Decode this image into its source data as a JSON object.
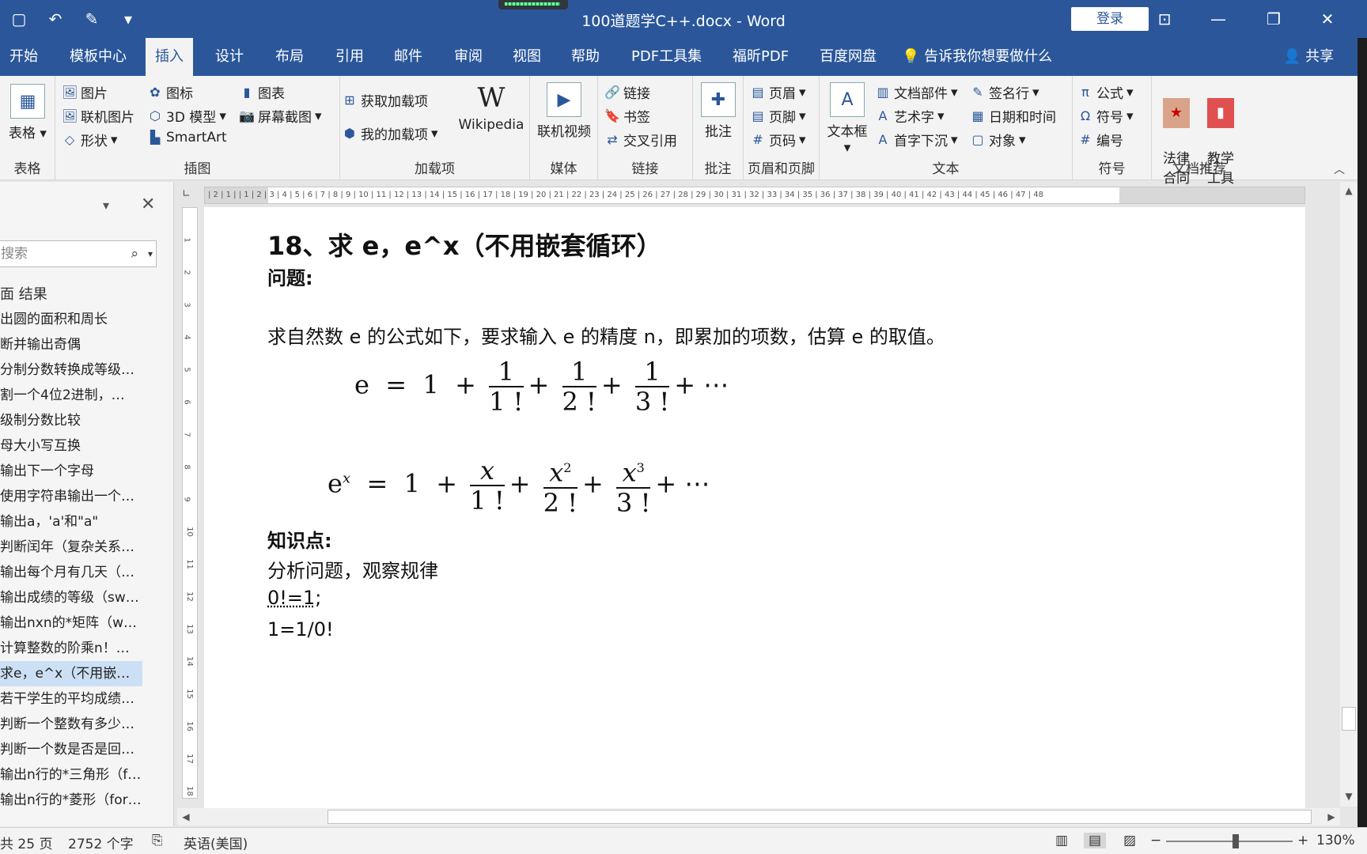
{
  "window": {
    "title": "100道题学C++.docx  -  Word",
    "login": "登录"
  },
  "tabs": [
    "开始",
    "模板中心",
    "插入",
    "设计",
    "布局",
    "引用",
    "邮件",
    "审阅",
    "视图",
    "帮助",
    "PDF工具集",
    "福昕PDF",
    "百度网盘"
  ],
  "active_tab": "插入",
  "tell_me": "告诉我你想要做什么",
  "share": "共享",
  "ribbon": {
    "table": {
      "btn": "表格",
      "group": "表格"
    },
    "illustrations": {
      "items": [
        "图片",
        "联机图片",
        "形状",
        "图标",
        "3D 模型",
        "SmartArt",
        "图表",
        "屏幕截图"
      ],
      "group": "插图"
    },
    "addins": {
      "items": [
        "获取加载项",
        "我的加载项",
        "Wikipedia"
      ],
      "group": "加载项"
    },
    "media": {
      "btn": "联机视频",
      "group": "媒体"
    },
    "links": {
      "items": [
        "链接",
        "书签",
        "交叉引用"
      ],
      "group": "链接"
    },
    "comments": {
      "btn": "批注",
      "group": "批注"
    },
    "header_footer": {
      "items": [
        "页眉",
        "页脚",
        "页码"
      ],
      "group": "页眉和页脚"
    },
    "text": {
      "textbox": "文本框",
      "items": [
        "文档部件",
        "艺术字",
        "首字下沉",
        "签名行",
        "日期和时间",
        "对象"
      ],
      "group": "文本"
    },
    "symbols": {
      "items": [
        "公式",
        "符号",
        "编号"
      ],
      "group": "符号"
    },
    "docrec": {
      "items": [
        "法律\n合同",
        "教学\n工具"
      ],
      "group": "文档推荐"
    }
  },
  "nav": {
    "search_placeholder": "搜索",
    "tabs": "面    结果",
    "items": [
      "出圆的面积和周长",
      "断并输出奇偶",
      "分制分数转换成等级…",
      "割一个4位2进制，…",
      "级制分数比较",
      "母大小写互换",
      "输出下一个字母",
      "使用字符串输出一个…",
      "输出a，'a'和\"a\"",
      "判断闰年（复杂关系…",
      "输出每个月有几天（…",
      "输出成绩的等级（sw…",
      "输出nxn的*矩阵（w…",
      "计算整数的阶乘n！…",
      "求e，e^x（不用嵌套…",
      "若干学生的平均成绩…",
      "判断一个整数有多少…",
      "判断一个数是否是回…",
      "输出n行的*三角形（f…",
      "输出n行的*菱形（for…"
    ],
    "selected_index": 14
  },
  "ruler": "| 2 | 1 |   | 1 | 2 | 3 | 4 | 5 | 6 | 7 | 8 | 9 | 10 | 11 | 12 | 13 | 14 | 15 | 16 | 17 | 18 | 19 | 20 | 21 | 22 | 23 | 24 | 25 | 26 | 27 | 28 | 29 | 30 | 31 | 32 | 33 | 34 | 35 | 36 | 37 | 38 | 39 | 40 | 41 | 42 | 43 | 44 | 45 | 46 | 47 | 48",
  "document": {
    "heading": "18、求 e，e^x（不用嵌套循环）",
    "problem_label": "问题:",
    "problem_text": "求自然数 e 的公式如下，要求输入 e 的精度 n，即累加的项数，估算 e 的取值。",
    "formula1": {
      "lhs": "e",
      "terms": [
        [
          "1",
          "1 !"
        ],
        [
          "1",
          "2 !"
        ],
        [
          "1",
          "3 !"
        ]
      ]
    },
    "formula2": {
      "lhs": "e",
      "lhs_sup": "x",
      "terms": [
        [
          "x",
          "1 !"
        ],
        [
          "x",
          "2 !"
        ],
        [
          "x",
          "3 !"
        ]
      ],
      "sups": [
        "",
        "2",
        "3"
      ]
    },
    "kp_label": "知识点:",
    "kp_lines": [
      "分析问题，观察规律",
      "0!=1;",
      "1=1/0!"
    ]
  },
  "status": {
    "pages": "共 25 页",
    "words": "2752 个字",
    "language": "英语(美国)",
    "zoom": "130%",
    "zoom_level": 0.55
  }
}
